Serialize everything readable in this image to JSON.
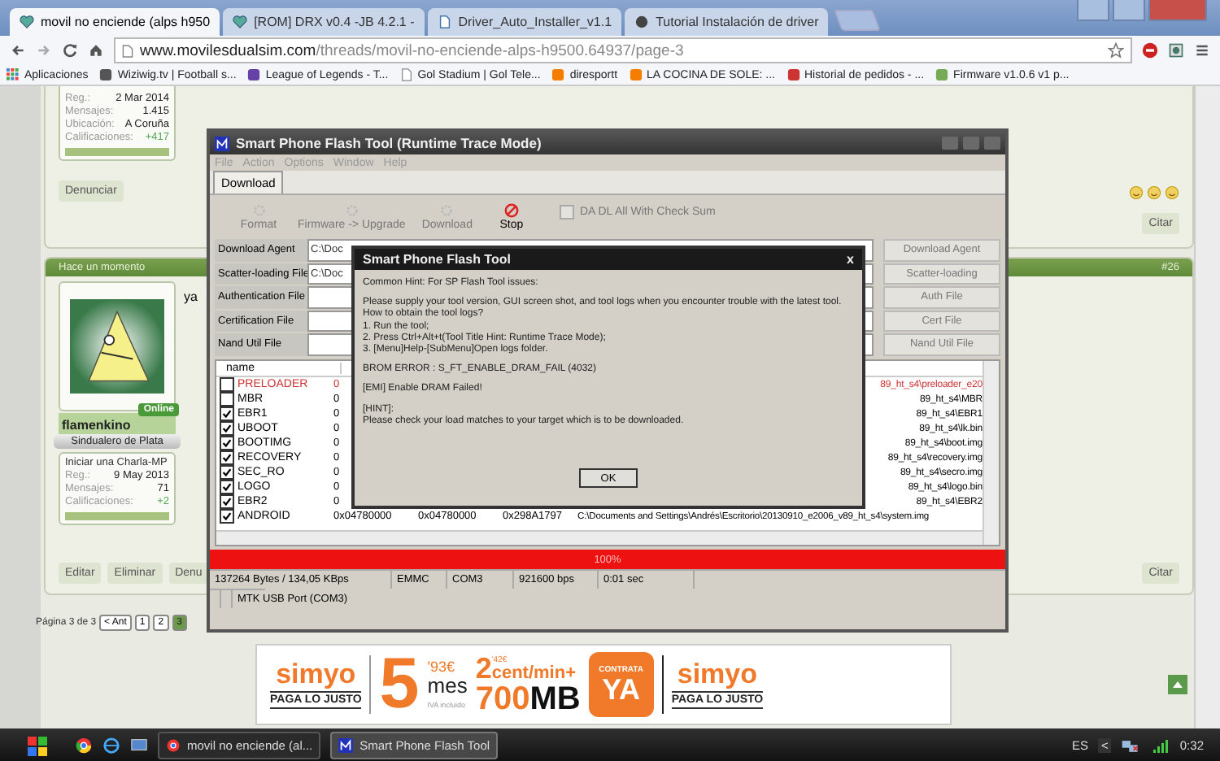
{
  "browser": {
    "tabs": [
      {
        "title": "movil no enciende (alps h950",
        "selected": true
      },
      {
        "title": "[ROM] DRX v0.4 -JB 4.2.1 -",
        "selected": false
      },
      {
        "title": "Driver_Auto_Installer_v1.1",
        "selected": false
      },
      {
        "title": "Tutorial Instalación de driver",
        "selected": false
      }
    ],
    "address": {
      "domain": "www.movilesdualsim.com",
      "path": "/threads/movil-no-enciende-alps-h9500.64937/page-3"
    },
    "bookmarks": [
      "Aplicaciones",
      "Wiziwig.tv | Football s...",
      "League of Legends - T...",
      "Gol Stadium | Gol Tele...",
      "diresportt",
      "LA COCINA DE SOLE: ...",
      "Historial de pedidos - ...",
      "Firmware v1.0.6 v1 p..."
    ]
  },
  "posts": [
    {
      "stats": [
        {
          "label": "Reg.:",
          "value": "2 Mar 2014"
        },
        {
          "label": "Mensajes:",
          "value": "1.415"
        },
        {
          "label": "Ubicación:",
          "value": "A Coruña"
        },
        {
          "label": "Calificaciones:",
          "value": "+417"
        }
      ],
      "actions": [
        "Denunciar"
      ],
      "quote": "Citar"
    },
    {
      "time": "Hace un momento",
      "number": "#26",
      "online": "Online",
      "username": "flamenkino",
      "rank": "Sindualero de Plata",
      "start_chat": "Iniciar una Charla-MP",
      "stats": [
        {
          "label": "Reg.:",
          "value": "9 May 2013"
        },
        {
          "label": "Mensajes:",
          "value": "71"
        },
        {
          "label": "Calificaciones:",
          "value": "+2"
        }
      ],
      "body": "ya",
      "actions": [
        "Editar",
        "Eliminar",
        "Denu"
      ],
      "quote": "Citar"
    }
  ],
  "pagination": {
    "label": "Página 3 de 3",
    "prev": "< Ant",
    "pages": [
      {
        "label": "1",
        "selected": false
      },
      {
        "label": "2",
        "selected": false
      },
      {
        "label": "3",
        "selected": true
      }
    ]
  },
  "flash_tool": {
    "title": "Smart Phone Flash Tool (Runtime Trace Mode)",
    "menu": [
      "File",
      "Action",
      "Options",
      "Window",
      "Help"
    ],
    "tab": "Download",
    "toolbar": [
      {
        "label": "Format",
        "disabled": true
      },
      {
        "label": "Firmware -> Upgrade",
        "disabled": true
      },
      {
        "label": "Download",
        "disabled": true
      },
      {
        "label": "Stop",
        "disabled": false
      }
    ],
    "checksum": {
      "label": "DA DL All With Check Sum",
      "checked": false
    },
    "fields": [
      {
        "label": "Download Agent",
        "value": "C:\\Doc"
      },
      {
        "label": "Scatter-loading File",
        "value": "C:\\Doc"
      },
      {
        "label": "Authentication File"
      },
      {
        "label": "Certification File"
      },
      {
        "label": "Nand Util File"
      }
    ],
    "side_buttons": [
      "Download Agent",
      "Scatter-loading",
      "Auth File",
      "Cert File",
      "Nand Util File"
    ],
    "table": {
      "column": "name",
      "rows": [
        {
          "name": "PRELOADER",
          "checked": false,
          "highlighted": true,
          "begin": "0",
          "path": "89_ht_s4\\preloader_e20"
        },
        {
          "name": "MBR",
          "checked": false,
          "highlighted": false,
          "begin": "0",
          "path": "89_ht_s4\\MBR"
        },
        {
          "name": "EBR1",
          "checked": true,
          "highlighted": false,
          "begin": "0",
          "path": "89_ht_s4\\EBR1"
        },
        {
          "name": "UBOOT",
          "checked": true,
          "highlighted": false,
          "begin": "0",
          "path": "89_ht_s4\\lk.bin"
        },
        {
          "name": "BOOTIMG",
          "checked": true,
          "highlighted": false,
          "begin": "0",
          "path": "89_ht_s4\\boot.img"
        },
        {
          "name": "RECOVERY",
          "checked": true,
          "highlighted": false,
          "begin": "0",
          "path": "89_ht_s4\\recovery.img"
        },
        {
          "name": "SEC_RO",
          "checked": true,
          "highlighted": false,
          "begin": "0",
          "path": "89_ht_s4\\secro.img"
        },
        {
          "name": "LOGO",
          "checked": true,
          "highlighted": false,
          "begin": "0",
          "path": "89_ht_s4\\logo.bin"
        },
        {
          "name": "EBR2",
          "checked": true,
          "highlighted": false,
          "begin": "0",
          "path": "89_ht_s4\\EBR2"
        },
        {
          "name": "ANDROID",
          "checked": true,
          "highlighted": false,
          "begin": "0x04780000",
          "end": "0x04780000",
          "length": "0x298A1797",
          "path": "C:\\Documents and Settings\\Andrés\\Escritorio\\20130910_e2006_v89_ht_s4\\system.img"
        }
      ]
    },
    "progress": {
      "level": 1,
      "label": "100%"
    },
    "status": [
      "137264 Bytes / 134,05 KBps",
      "EMMC",
      "COM3",
      "921600 bps",
      "0:01 sec"
    ],
    "port": "MTK USB Port (COM3)"
  },
  "dialog": {
    "title": "Smart Phone Flash Tool",
    "close": "x",
    "paragraphs": [
      [
        "Common Hint: For SP Flash Tool issues:"
      ],
      [
        "Please supply your tool version, GUI screen shot, and tool logs when you encounter trouble with the latest tool.",
        "How to obtain the tool logs?",
        "1. Run the tool;",
        "2. Press Ctrl+Alt+t(Tool Title Hint: Runtime Trace Mode);",
        "3. [Menu]Help-[SubMenu]Open logs folder."
      ],
      [
        "BROM ERROR : S_FT_ENABLE_DRAM_FAIL (4032)"
      ],
      [
        "[EMI] Enable DRAM Failed!"
      ],
      [
        "[HINT]:",
        "Please check your load matches to your target which is to be downloaded."
      ]
    ],
    "button": "OK"
  },
  "ad": {
    "brand": "simyo",
    "slogan": "PAGA LO JUSTO",
    "price_big": "5",
    "price_small": "'93€",
    "price_unit": "mes",
    "tax": "IVA incluido",
    "call_big": "2",
    "call_small": "'42€",
    "call_unit": "cent/min+",
    "data_num": "700",
    "data_unit": "MB",
    "cta_top": "CONTRATA",
    "cta": "YA",
    "brand_2": "simyo",
    "slogan_2": "PAGA LO JUSTO"
  },
  "taskbar": {
    "tasks": [
      {
        "label": "movil no enciende (al...",
        "selected": false
      },
      {
        "label": "Smart Phone Flash Tool",
        "selected": true
      }
    ],
    "language": "ES",
    "tray_toggle": "<",
    "clock": "0:32"
  }
}
